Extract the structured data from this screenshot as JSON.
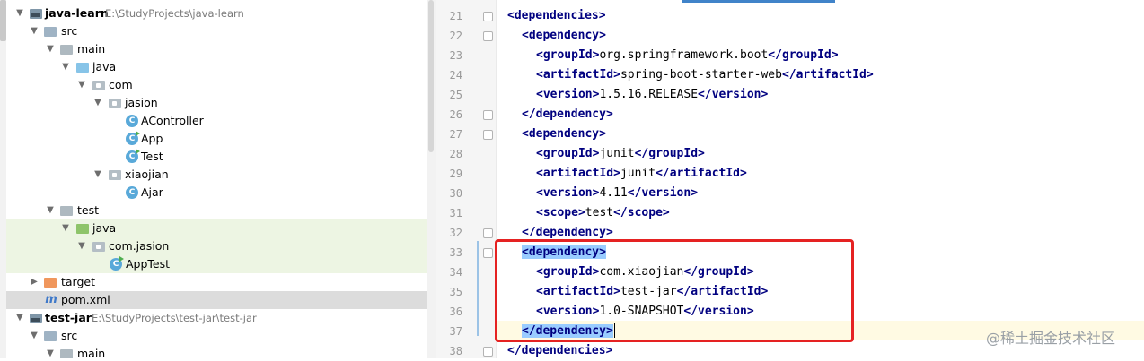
{
  "project_tree": [
    {
      "label": "java-learn",
      "path": "E:\\StudyProjects\\java-learn",
      "bold": true
    },
    {
      "label": "src"
    },
    {
      "label": "main"
    },
    {
      "label": "java"
    },
    {
      "label": "com"
    },
    {
      "label": "jasion"
    },
    {
      "label": "AController"
    },
    {
      "label": "App"
    },
    {
      "label": "Test"
    },
    {
      "label": "xiaojian"
    },
    {
      "label": "Ajar"
    },
    {
      "label": "test"
    },
    {
      "label": "java"
    },
    {
      "label": "com.jasion"
    },
    {
      "label": "AppTest"
    },
    {
      "label": "target"
    },
    {
      "label": "pom.xml",
      "file_icon": "m"
    },
    {
      "label": "test-jar",
      "path": "E:\\StudyProjects\\test-jar\\test-jar",
      "bold": true
    },
    {
      "label": "src"
    },
    {
      "label": "main"
    }
  ],
  "icons": {
    "class_letter": "C"
  },
  "editor": {
    "line_numbers": [
      "21",
      "22",
      "23",
      "24",
      "25",
      "26",
      "27",
      "28",
      "29",
      "30",
      "31",
      "32",
      "33",
      "34",
      "35",
      "36",
      "37",
      "38"
    ],
    "lines": [
      {
        "open": "dependencies"
      },
      {
        "open": "dependency"
      },
      {
        "open": "groupId",
        "text": "org.springframework.boot",
        "close": "groupId"
      },
      {
        "open": "artifactId",
        "text": "spring-boot-starter-web",
        "close": "artifactId"
      },
      {
        "open": "version",
        "text": "1.5.16.RELEASE",
        "close": "version"
      },
      {
        "close": "dependency"
      },
      {
        "open": "dependency"
      },
      {
        "open": "groupId",
        "text": "junit",
        "close": "groupId"
      },
      {
        "open": "artifactId",
        "text": "junit",
        "close": "artifactId"
      },
      {
        "open": "version",
        "text": "4.11",
        "close": "version"
      },
      {
        "open": "scope",
        "text": "test",
        "close": "scope"
      },
      {
        "close": "dependency"
      },
      {
        "open": "dependency"
      },
      {
        "open": "groupId",
        "text": "com.xiaojian",
        "close": "groupId"
      },
      {
        "open": "artifactId",
        "text": "test-jar",
        "close": "artifactId"
      },
      {
        "open": "version",
        "text": "1.0-SNAPSHOT",
        "close": "version"
      },
      {
        "close": "dependency"
      },
      {
        "close": "dependencies"
      }
    ]
  },
  "watermark": "@稀土掘金技术社区",
  "colors": {
    "tag": "#000080",
    "highlight_box": "#e52222",
    "matched_tag_bg": "#99ccff"
  }
}
